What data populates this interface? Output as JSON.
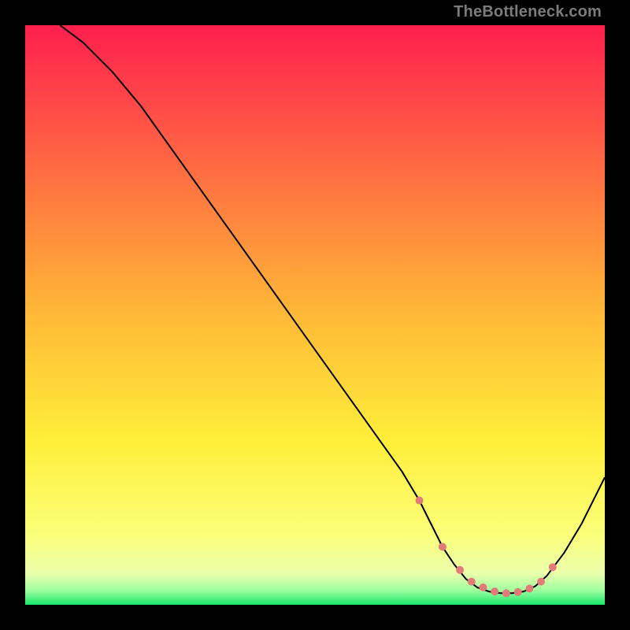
{
  "watermark": "TheBottleneck.com",
  "chart_data": {
    "type": "line",
    "title": "",
    "xlabel": "",
    "ylabel": "",
    "xlim": [
      0,
      100
    ],
    "ylim": [
      0,
      100
    ],
    "background_gradient": {
      "stops": [
        {
          "offset": 0.0,
          "color": "#ff1f4e"
        },
        {
          "offset": 0.5,
          "color": "#ffb937"
        },
        {
          "offset": 0.72,
          "color": "#ffef3a"
        },
        {
          "offset": 0.88,
          "color": "#fbff7a"
        },
        {
          "offset": 0.945,
          "color": "#ecffab"
        },
        {
          "offset": 0.975,
          "color": "#9fff9f"
        },
        {
          "offset": 1.0,
          "color": "#17e66a"
        }
      ]
    },
    "series": [
      {
        "name": "bottleneck-curve",
        "color": "#000000",
        "stroke_width": 2,
        "x": [
          6,
          10,
          15,
          20,
          25,
          30,
          35,
          40,
          45,
          50,
          55,
          60,
          65,
          68,
          70,
          72,
          74,
          76,
          78,
          80,
          82,
          84,
          86,
          88,
          90,
          93,
          96,
          100
        ],
        "y": [
          100,
          97,
          92,
          86,
          79,
          72,
          65,
          58,
          51,
          44,
          37,
          30,
          23,
          18,
          14,
          10,
          7,
          4.5,
          3,
          2.3,
          2.0,
          2.0,
          2.3,
          3.2,
          5,
          9,
          14,
          22
        ]
      }
    ],
    "markers": {
      "name": "highlight-dots",
      "color": "#e47a78",
      "radius": 5,
      "x": [
        68,
        72,
        75,
        77,
        79,
        81,
        83,
        85,
        87,
        89,
        91
      ],
      "y": [
        18,
        10,
        6,
        4,
        3,
        2.3,
        2.0,
        2.2,
        2.8,
        4,
        6.5
      ]
    }
  }
}
